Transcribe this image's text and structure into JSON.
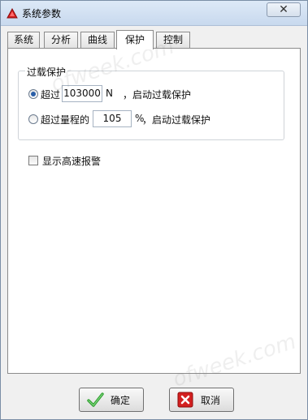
{
  "window": {
    "title": "系统参数",
    "close_symbol": "✕",
    "icon": "app-red-triangle-icon"
  },
  "tabs": [
    {
      "label": "系统",
      "active": false
    },
    {
      "label": "分析",
      "active": false
    },
    {
      "label": "曲线",
      "active": false
    },
    {
      "label": "保护",
      "active": true
    },
    {
      "label": "控制",
      "active": false
    }
  ],
  "overload": {
    "group_title": "过载保护",
    "option1": {
      "selected": true,
      "prefix": "超过",
      "value": "103000",
      "unit": "N",
      "suffix": "，启动过载保护"
    },
    "option2": {
      "selected": false,
      "prefix": "超过量程的",
      "value": "105",
      "unit": "%",
      "suffix": "，启动过载保护"
    }
  },
  "high_speed_alarm": {
    "label": "显示高速报警",
    "checked": false
  },
  "buttons": {
    "ok_label": "确定",
    "ok_icon": "green-check-icon",
    "cancel_label": "取消",
    "cancel_icon": "red-x-icon"
  },
  "watermark_text": "ofweek.com"
}
